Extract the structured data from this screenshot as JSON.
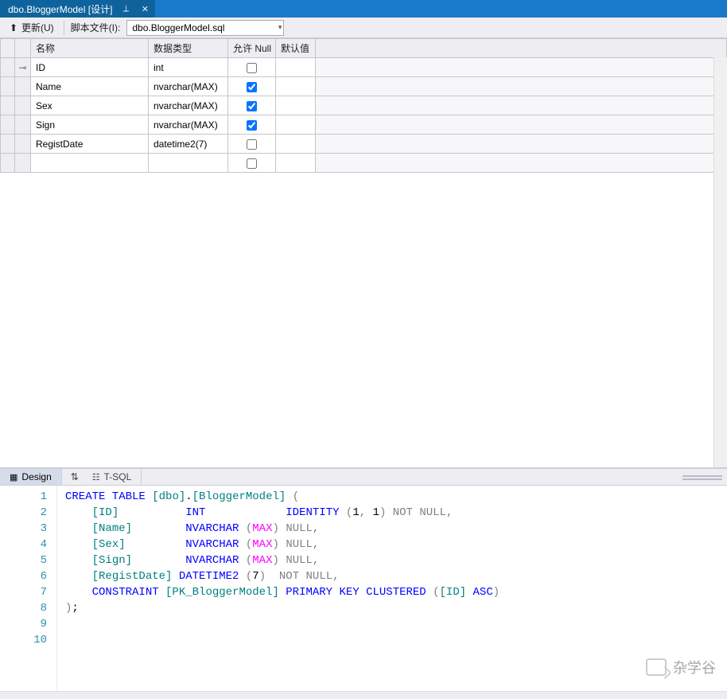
{
  "tab": {
    "title": "dbo.BloggerModel [设计]",
    "pin_glyph": "⟂",
    "close_glyph": "✕"
  },
  "toolbar": {
    "update_label": "更新(U)",
    "script_file_label": "脚本文件(I):",
    "script_file_value": "dbo.BloggerModel.sql",
    "update_arrow": "⬆"
  },
  "grid": {
    "headers": {
      "name": "名称",
      "type": "数据类型",
      "allow_null": "允许 Null",
      "default": "默认值"
    },
    "rows": [
      {
        "pk": true,
        "name": "ID",
        "type": "int",
        "null": false,
        "default": ""
      },
      {
        "pk": false,
        "name": "Name",
        "type": "nvarchar(MAX)",
        "null": true,
        "default": ""
      },
      {
        "pk": false,
        "name": "Sex",
        "type": "nvarchar(MAX)",
        "null": true,
        "default": ""
      },
      {
        "pk": false,
        "name": "Sign",
        "type": "nvarchar(MAX)",
        "null": true,
        "default": ""
      },
      {
        "pk": false,
        "name": "RegistDate",
        "type": "datetime2(7)",
        "null": false,
        "default": ""
      }
    ],
    "pk_glyph": "⊸"
  },
  "lower_tabs": {
    "design": "Design",
    "tsql": "T-SQL",
    "swap_glyph": "⇅"
  },
  "sql": {
    "line_count": 10,
    "tokens": [
      [
        [
          "kw",
          "CREATE TABLE"
        ],
        [
          "plain",
          " "
        ],
        [
          "ident",
          "[dbo]"
        ],
        [
          "plain",
          "."
        ],
        [
          "ident",
          "[BloggerModel]"
        ],
        [
          "plain",
          " "
        ],
        [
          "paren",
          "("
        ]
      ],
      [
        [
          "plain",
          "    "
        ],
        [
          "ident",
          "[ID]"
        ],
        [
          "plain",
          "          "
        ],
        [
          "kw",
          "INT"
        ],
        [
          "plain",
          "            "
        ],
        [
          "func",
          "IDENTITY"
        ],
        [
          "plain",
          " "
        ],
        [
          "paren",
          "("
        ],
        [
          "num",
          "1"
        ],
        [
          "paren",
          ","
        ],
        [
          "plain",
          " "
        ],
        [
          "num",
          "1"
        ],
        [
          "paren",
          ")"
        ],
        [
          "plain",
          " "
        ],
        [
          "null",
          "NOT NULL"
        ],
        [
          "paren",
          ","
        ]
      ],
      [
        [
          "plain",
          "    "
        ],
        [
          "ident",
          "[Name]"
        ],
        [
          "plain",
          "        "
        ],
        [
          "kw",
          "NVARCHAR"
        ],
        [
          "plain",
          " "
        ],
        [
          "paren",
          "("
        ],
        [
          "max",
          "MAX"
        ],
        [
          "paren",
          ")"
        ],
        [
          "plain",
          " "
        ],
        [
          "null",
          "NULL"
        ],
        [
          "paren",
          ","
        ]
      ],
      [
        [
          "plain",
          "    "
        ],
        [
          "ident",
          "[Sex]"
        ],
        [
          "plain",
          "         "
        ],
        [
          "kw",
          "NVARCHAR"
        ],
        [
          "plain",
          " "
        ],
        [
          "paren",
          "("
        ],
        [
          "max",
          "MAX"
        ],
        [
          "paren",
          ")"
        ],
        [
          "plain",
          " "
        ],
        [
          "null",
          "NULL"
        ],
        [
          "paren",
          ","
        ]
      ],
      [
        [
          "plain",
          "    "
        ],
        [
          "ident",
          "[Sign]"
        ],
        [
          "plain",
          "        "
        ],
        [
          "kw",
          "NVARCHAR"
        ],
        [
          "plain",
          " "
        ],
        [
          "paren",
          "("
        ],
        [
          "max",
          "MAX"
        ],
        [
          "paren",
          ")"
        ],
        [
          "plain",
          " "
        ],
        [
          "null",
          "NULL"
        ],
        [
          "paren",
          ","
        ]
      ],
      [
        [
          "plain",
          "    "
        ],
        [
          "ident",
          "[RegistDate]"
        ],
        [
          "plain",
          " "
        ],
        [
          "kw",
          "DATETIME2"
        ],
        [
          "plain",
          " "
        ],
        [
          "paren",
          "("
        ],
        [
          "num",
          "7"
        ],
        [
          "paren",
          ")"
        ],
        [
          "plain",
          "  "
        ],
        [
          "null",
          "NOT NULL"
        ],
        [
          "paren",
          ","
        ]
      ],
      [
        [
          "plain",
          "    "
        ],
        [
          "kw",
          "CONSTRAINT"
        ],
        [
          "plain",
          " "
        ],
        [
          "ident",
          "[PK_BloggerModel]"
        ],
        [
          "plain",
          " "
        ],
        [
          "kw",
          "PRIMARY KEY CLUSTERED"
        ],
        [
          "plain",
          " "
        ],
        [
          "paren",
          "("
        ],
        [
          "ident",
          "[ID]"
        ],
        [
          "plain",
          " "
        ],
        [
          "kw",
          "ASC"
        ],
        [
          "paren",
          ")"
        ]
      ],
      [
        [
          "paren",
          ")"
        ],
        [
          "plain",
          ";"
        ]
      ],
      [
        [
          "plain",
          ""
        ]
      ],
      [
        [
          "plain",
          ""
        ]
      ]
    ]
  },
  "watermark": {
    "text": "杂学谷"
  }
}
